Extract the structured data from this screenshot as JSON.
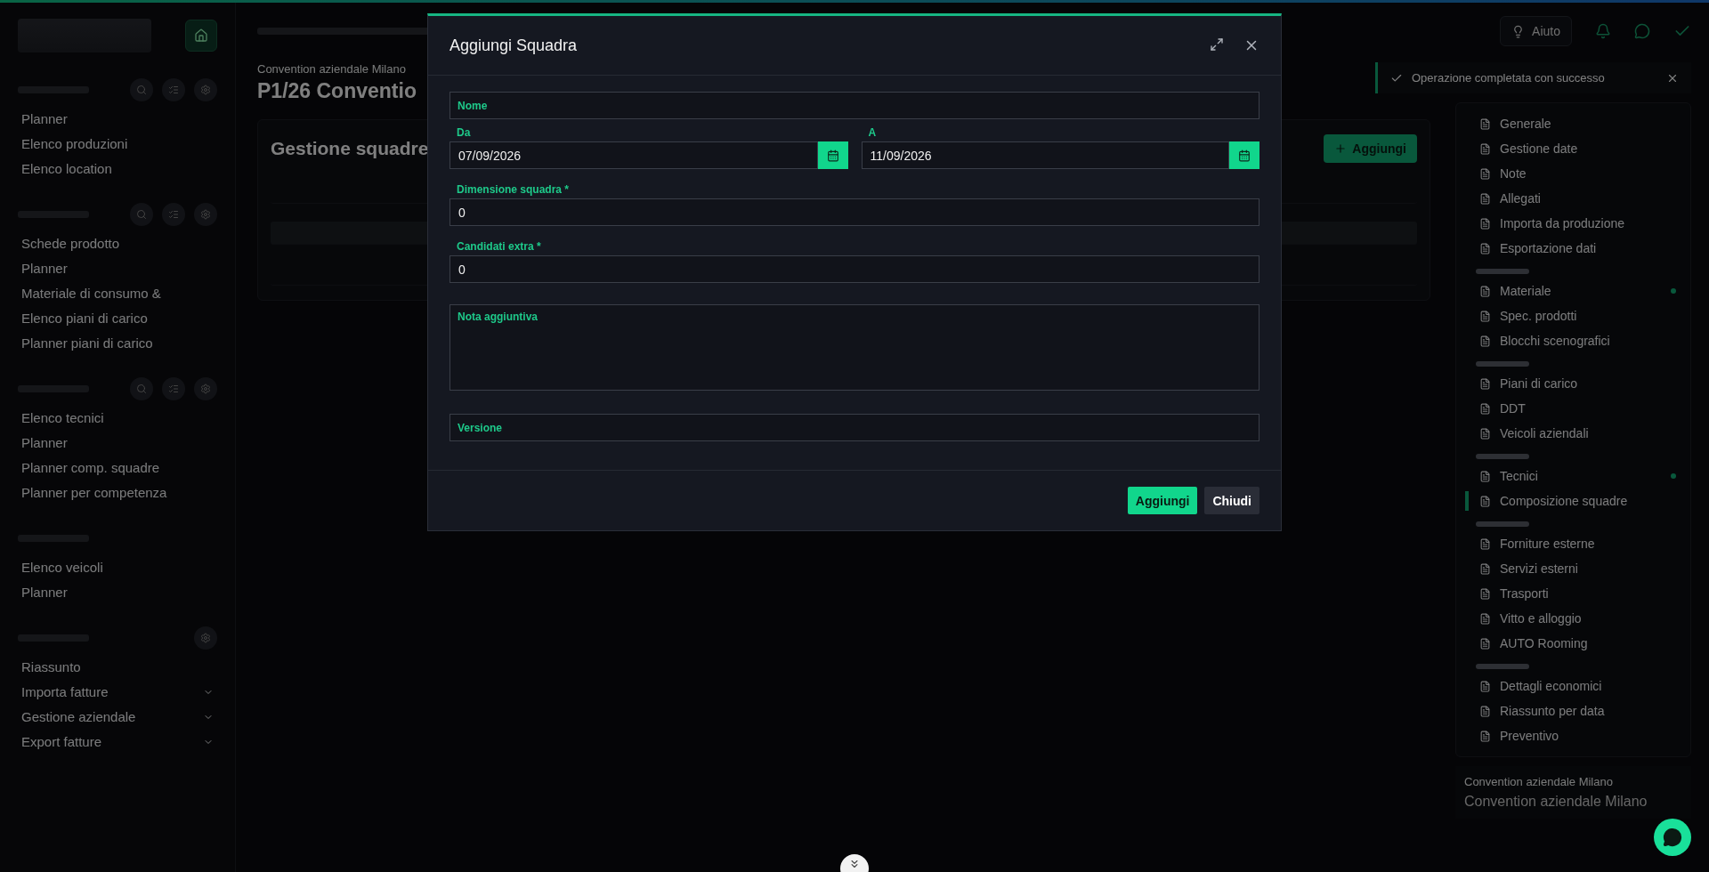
{
  "top_bar": {
    "help_button": "Aiuto"
  },
  "sidebar": {
    "sections": [
      {
        "kind": "tools",
        "items": [
          {
            "label": "Planner",
            "expandable": false
          },
          {
            "label": "Elenco produzioni",
            "expandable": false
          },
          {
            "label": "Elenco location",
            "expandable": false
          }
        ]
      },
      {
        "kind": "tools",
        "items": [
          {
            "label": "Schede prodotto",
            "expandable": false
          },
          {
            "label": "Planner",
            "expandable": false
          },
          {
            "label": "Materiale di consumo &",
            "expandable": false
          },
          {
            "label": "Elenco piani di carico",
            "expandable": false
          },
          {
            "label": "Planner piani di carico",
            "expandable": false
          }
        ]
      },
      {
        "kind": "tools",
        "items": [
          {
            "label": "Elenco tecnici",
            "expandable": false
          },
          {
            "label": "Planner",
            "expandable": false
          },
          {
            "label": "Planner comp. squadre",
            "expandable": false
          },
          {
            "label": "Planner per competenza",
            "expandable": false
          }
        ]
      },
      {
        "kind": "plain",
        "items": [
          {
            "label": "Elenco veicoli",
            "expandable": false
          },
          {
            "label": "Planner",
            "expandable": false
          }
        ]
      },
      {
        "kind": "single",
        "items": [
          {
            "label": "Riassunto",
            "expandable": false
          },
          {
            "label": "Importa fatture",
            "expandable": true
          },
          {
            "label": "Gestione aziendale",
            "expandable": true
          },
          {
            "label": "Export fatture",
            "expandable": true
          }
        ]
      }
    ]
  },
  "page": {
    "subtitle": "Convention aziendale Milano",
    "title": "P1/26 Conventio",
    "card_title": "Gestione squadre",
    "add_button": "Aggiungi"
  },
  "toast": {
    "message": "Operazione completata con successo"
  },
  "side_nav": {
    "sections": [
      {
        "items": [
          {
            "label": "Generale",
            "selected": false,
            "dot": false
          },
          {
            "label": "Gestione date",
            "selected": false,
            "dot": false
          },
          {
            "label": "Note",
            "selected": false,
            "dot": false
          },
          {
            "label": "Allegati",
            "selected": false,
            "dot": false
          },
          {
            "label": "Importa da produzione",
            "selected": false,
            "dot": false
          },
          {
            "label": "Esportazione dati",
            "selected": false,
            "dot": false
          }
        ]
      },
      {
        "items": [
          {
            "label": "Materiale",
            "selected": false,
            "dot": true
          },
          {
            "label": "Spec. prodotti",
            "selected": false,
            "dot": false
          },
          {
            "label": "Blocchi scenografici",
            "selected": false,
            "dot": false
          }
        ]
      },
      {
        "items": [
          {
            "label": "Piani di carico",
            "selected": false,
            "dot": false
          },
          {
            "label": "DDT",
            "selected": false,
            "dot": false
          },
          {
            "label": "Veicoli aziendali",
            "selected": false,
            "dot": false
          }
        ]
      },
      {
        "items": [
          {
            "label": "Tecnici",
            "selected": false,
            "dot": true
          },
          {
            "label": "Composizione squadre",
            "selected": true,
            "dot": false
          }
        ]
      },
      {
        "items": [
          {
            "label": "Forniture esterne",
            "selected": false,
            "dot": false
          },
          {
            "label": "Servizi esterni",
            "selected": false,
            "dot": false
          },
          {
            "label": "Trasporti",
            "selected": false,
            "dot": false
          },
          {
            "label": "Vitto e alloggio",
            "selected": false,
            "dot": false
          },
          {
            "label": "AUTO Rooming",
            "selected": false,
            "dot": false
          }
        ]
      },
      {
        "items": [
          {
            "label": "Dettagli economici",
            "selected": false,
            "dot": false
          },
          {
            "label": "Riassunto per data",
            "selected": false,
            "dot": false
          },
          {
            "label": "Preventivo",
            "selected": false,
            "dot": false
          }
        ]
      }
    ]
  },
  "event_card": {
    "subtitle": "Convention aziendale Milano",
    "title": "Convention aziendale Milano"
  },
  "modal": {
    "title": "Aggiungi Squadra",
    "fields": [
      {
        "kind": "text",
        "label": "Nome"
      },
      {
        "kind": "date_pair",
        "dates": [
          {
            "label": "Da",
            "value": "07/09/2026"
          },
          {
            "label": "A",
            "value": "11/09/2026"
          }
        ]
      },
      {
        "kind": "text",
        "label": "Dimensione squadra *",
        "value": "0"
      },
      {
        "kind": "text",
        "label": "Candidati extra *",
        "value": "0"
      },
      {
        "kind": "textarea",
        "label": "Nota aggiuntiva"
      },
      {
        "kind": "text",
        "label": "Versione"
      }
    ],
    "buttons": [
      {
        "label": "Aggiungi",
        "kind": "primary"
      },
      {
        "label": "Chiudi",
        "kind": "secondary"
      }
    ]
  }
}
